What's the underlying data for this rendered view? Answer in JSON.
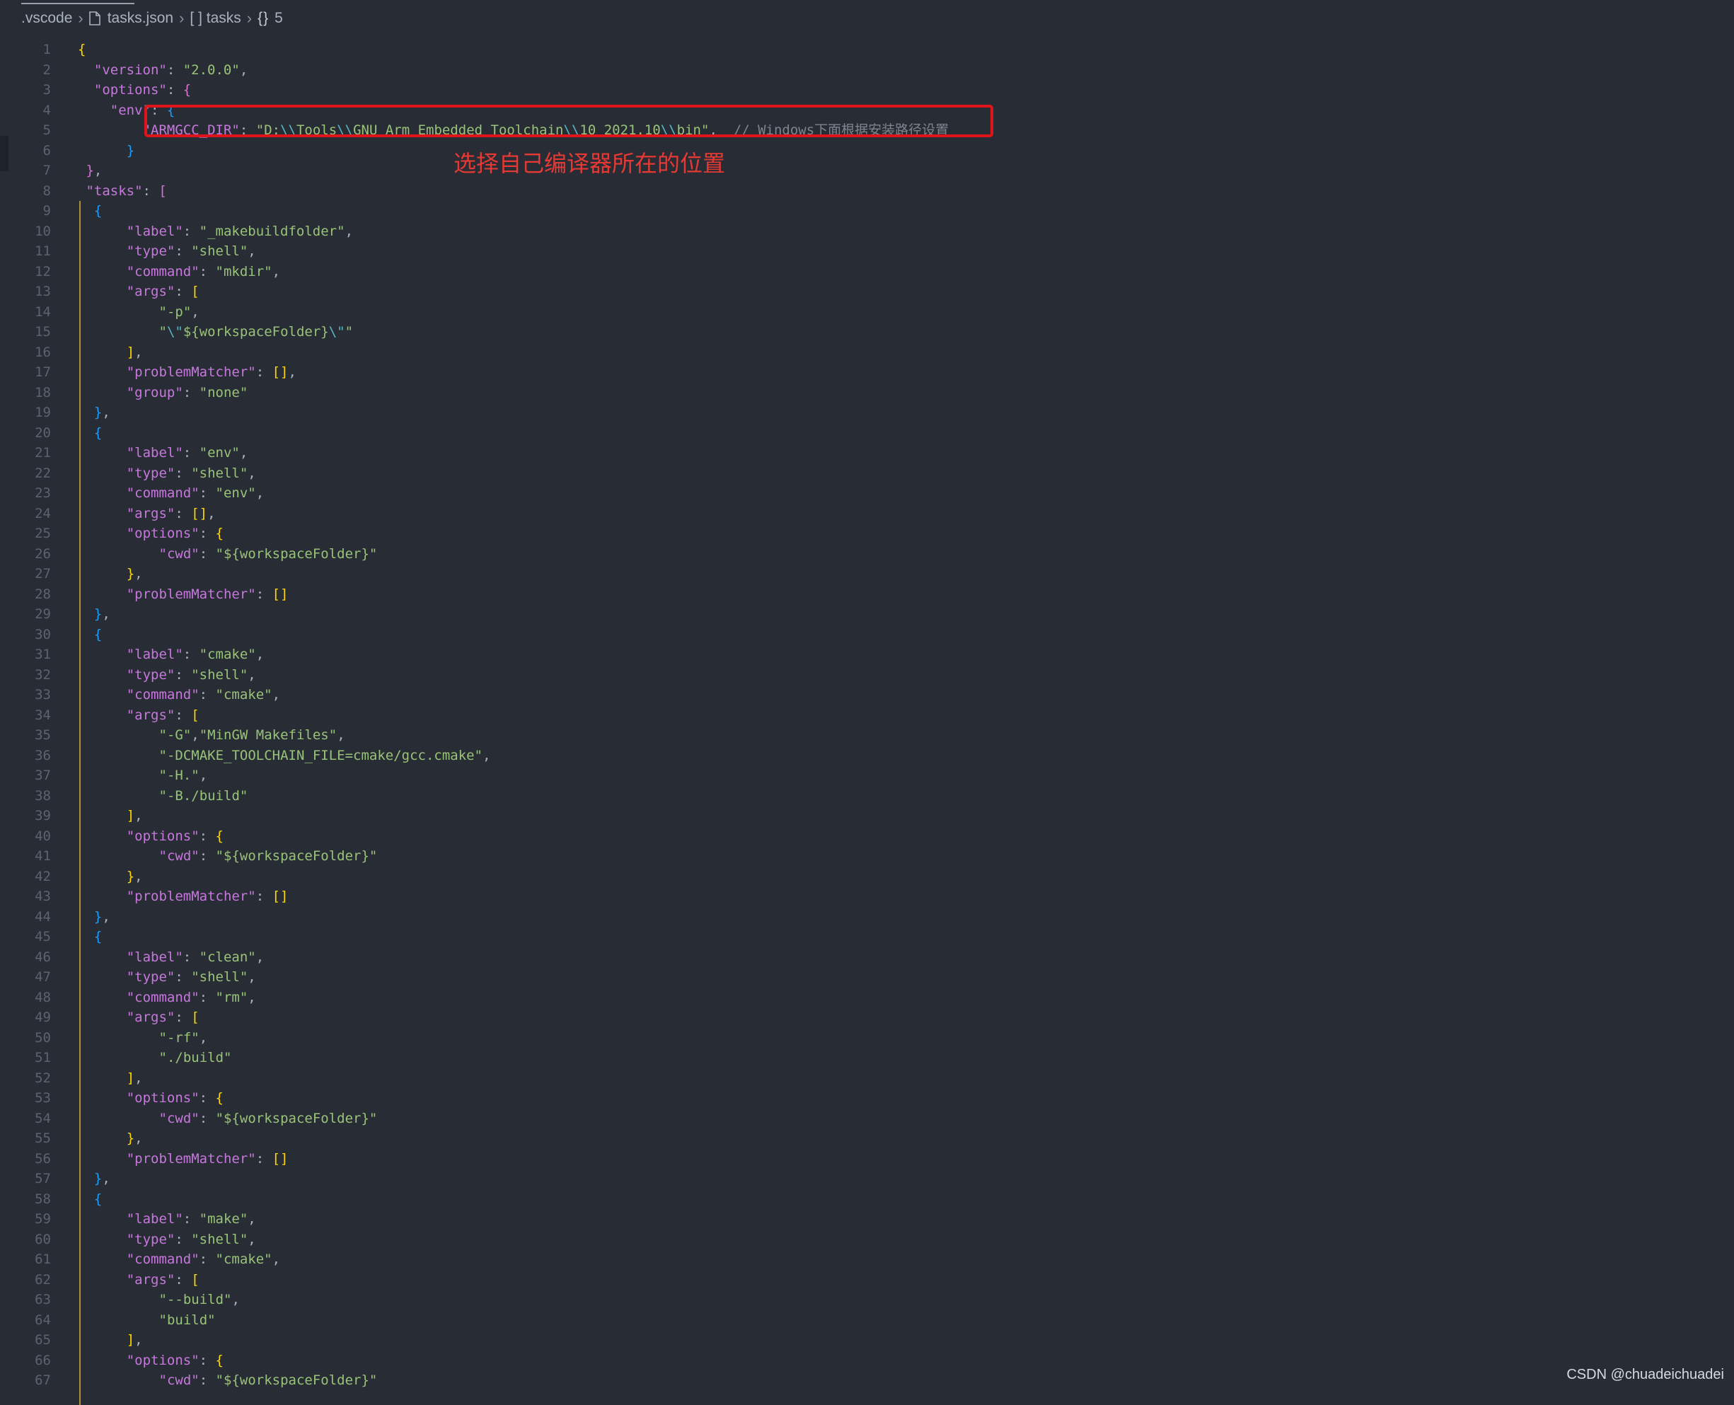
{
  "breadcrumb": {
    "items": [
      ".vscode",
      "tasks.json",
      "[ ] tasks",
      "5"
    ],
    "symbol_icon_text": "{}",
    "separator": "›"
  },
  "annotation": {
    "text": "选择自己编译器所在的位置"
  },
  "watermark": "CSDN @chuadeichuadei",
  "colors": {
    "background": "#282c34",
    "key": "#c678dd",
    "string": "#98c379",
    "comment": "#7f848e",
    "highlight_box": "#e0151c",
    "annotation": "#e53935"
  },
  "code_lines": [
    [
      [
        "{",
        "br1"
      ]
    ],
    [
      [
        "\"version\"",
        "t-key"
      ],
      [
        ": ",
        "t-punc"
      ],
      [
        "\"2.0.0\"",
        "t-str"
      ],
      [
        ",",
        "t-punc"
      ]
    ],
    [
      [
        "\"options\"",
        "t-key"
      ],
      [
        ": ",
        "t-punc"
      ],
      [
        "{",
        "br2"
      ]
    ],
    [
      [
        "\"env\"",
        "t-key"
      ],
      [
        ": ",
        "t-punc"
      ],
      [
        "{",
        "br3"
      ]
    ],
    [
      [
        "\"ARMGCC_DIR\"",
        "t-key"
      ],
      [
        ": ",
        "t-punc"
      ],
      [
        "\"D:",
        "t-str"
      ],
      [
        "\\\\",
        "t-esc"
      ],
      [
        "Tools",
        "t-str"
      ],
      [
        "\\\\",
        "t-esc"
      ],
      [
        "GNU Arm Embedded Toolchain",
        "t-str"
      ],
      [
        "\\\\",
        "t-esc"
      ],
      [
        "10 2021.10",
        "t-str"
      ],
      [
        "\\\\",
        "t-esc"
      ],
      [
        "bin\"",
        "t-str"
      ],
      [
        ",  ",
        "t-punc"
      ],
      [
        "// Windows下面根据安装路径设置",
        "t-com"
      ]
    ],
    [
      [
        "}",
        "br3"
      ]
    ],
    [
      [
        "}",
        "br2"
      ],
      [
        ",",
        "t-punc"
      ]
    ],
    [
      [
        "\"tasks\"",
        "t-key"
      ],
      [
        ": ",
        "t-punc"
      ],
      [
        "[",
        "br2"
      ]
    ],
    [
      [
        "{",
        "br3"
      ]
    ],
    [
      [
        "\"label\"",
        "t-key"
      ],
      [
        ": ",
        "t-punc"
      ],
      [
        "\"_makebuildfolder\"",
        "t-str"
      ],
      [
        ",",
        "t-punc"
      ]
    ],
    [
      [
        "\"type\"",
        "t-key"
      ],
      [
        ": ",
        "t-punc"
      ],
      [
        "\"shell\"",
        "t-str"
      ],
      [
        ",",
        "t-punc"
      ]
    ],
    [
      [
        "\"command\"",
        "t-key"
      ],
      [
        ": ",
        "t-punc"
      ],
      [
        "\"mkdir\"",
        "t-str"
      ],
      [
        ",",
        "t-punc"
      ]
    ],
    [
      [
        "\"args\"",
        "t-key"
      ],
      [
        ": ",
        "t-punc"
      ],
      [
        "[",
        "br1"
      ]
    ],
    [
      [
        "\"-p\"",
        "t-str"
      ],
      [
        ",",
        "t-punc"
      ]
    ],
    [
      [
        "\"",
        "t-str"
      ],
      [
        "\\\"",
        "t-esc"
      ],
      [
        "${workspaceFolder}",
        "t-str"
      ],
      [
        "\\\"",
        "t-esc"
      ],
      [
        "\"",
        "t-str"
      ]
    ],
    [
      [
        "]",
        "br1"
      ],
      [
        ",",
        "t-punc"
      ]
    ],
    [
      [
        "\"problemMatcher\"",
        "t-key"
      ],
      [
        ": ",
        "t-punc"
      ],
      [
        "[]",
        "br1"
      ],
      [
        ",",
        "t-punc"
      ]
    ],
    [
      [
        "\"group\"",
        "t-key"
      ],
      [
        ": ",
        "t-punc"
      ],
      [
        "\"none\"",
        "t-str"
      ]
    ],
    [
      [
        "}",
        "br3"
      ],
      [
        ",",
        "t-punc"
      ]
    ],
    [
      [
        "{",
        "br3"
      ]
    ],
    [
      [
        "\"label\"",
        "t-key"
      ],
      [
        ": ",
        "t-punc"
      ],
      [
        "\"env\"",
        "t-str"
      ],
      [
        ",",
        "t-punc"
      ]
    ],
    [
      [
        "\"type\"",
        "t-key"
      ],
      [
        ": ",
        "t-punc"
      ],
      [
        "\"shell\"",
        "t-str"
      ],
      [
        ",",
        "t-punc"
      ]
    ],
    [
      [
        "\"command\"",
        "t-key"
      ],
      [
        ": ",
        "t-punc"
      ],
      [
        "\"env\"",
        "t-str"
      ],
      [
        ",",
        "t-punc"
      ]
    ],
    [
      [
        "\"args\"",
        "t-key"
      ],
      [
        ": ",
        "t-punc"
      ],
      [
        "[]",
        "br1"
      ],
      [
        ",",
        "t-punc"
      ]
    ],
    [
      [
        "\"options\"",
        "t-key"
      ],
      [
        ": ",
        "t-punc"
      ],
      [
        "{",
        "br1"
      ]
    ],
    [
      [
        "\"cwd\"",
        "t-key"
      ],
      [
        ": ",
        "t-punc"
      ],
      [
        "\"${workspaceFolder}\"",
        "t-str"
      ]
    ],
    [
      [
        "}",
        "br1"
      ],
      [
        ",",
        "t-punc"
      ]
    ],
    [
      [
        "\"problemMatcher\"",
        "t-key"
      ],
      [
        ": ",
        "t-punc"
      ],
      [
        "[]",
        "br1"
      ]
    ],
    [
      [
        "}",
        "br3"
      ],
      [
        ",",
        "t-punc"
      ]
    ],
    [
      [
        "{",
        "br3"
      ]
    ],
    [
      [
        "\"label\"",
        "t-key"
      ],
      [
        ": ",
        "t-punc"
      ],
      [
        "\"cmake\"",
        "t-str"
      ],
      [
        ",",
        "t-punc"
      ]
    ],
    [
      [
        "\"type\"",
        "t-key"
      ],
      [
        ": ",
        "t-punc"
      ],
      [
        "\"shell\"",
        "t-str"
      ],
      [
        ",",
        "t-punc"
      ]
    ],
    [
      [
        "\"command\"",
        "t-key"
      ],
      [
        ": ",
        "t-punc"
      ],
      [
        "\"cmake\"",
        "t-str"
      ],
      [
        ",",
        "t-punc"
      ]
    ],
    [
      [
        "\"args\"",
        "t-key"
      ],
      [
        ": ",
        "t-punc"
      ],
      [
        "[",
        "br1"
      ]
    ],
    [
      [
        "\"-G\"",
        "t-str"
      ],
      [
        ",",
        "t-punc"
      ],
      [
        "\"MinGW Makefiles\"",
        "t-str"
      ],
      [
        ",",
        "t-punc"
      ]
    ],
    [
      [
        "\"-DCMAKE_TOOLCHAIN_FILE=cmake/gcc.cmake\"",
        "t-str"
      ],
      [
        ",",
        "t-punc"
      ]
    ],
    [
      [
        "\"-H.\"",
        "t-str"
      ],
      [
        ",",
        "t-punc"
      ]
    ],
    [
      [
        "\"-B./build\"",
        "t-str"
      ]
    ],
    [
      [
        "]",
        "br1"
      ],
      [
        ",",
        "t-punc"
      ]
    ],
    [
      [
        "\"options\"",
        "t-key"
      ],
      [
        ": ",
        "t-punc"
      ],
      [
        "{",
        "br1"
      ]
    ],
    [
      [
        "\"cwd\"",
        "t-key"
      ],
      [
        ": ",
        "t-punc"
      ],
      [
        "\"${workspaceFolder}\"",
        "t-str"
      ]
    ],
    [
      [
        "}",
        "br1"
      ],
      [
        ",",
        "t-punc"
      ]
    ],
    [
      [
        "\"problemMatcher\"",
        "t-key"
      ],
      [
        ": ",
        "t-punc"
      ],
      [
        "[]",
        "br1"
      ]
    ],
    [
      [
        "}",
        "br3"
      ],
      [
        ",",
        "t-punc"
      ]
    ],
    [
      [
        "{",
        "br3"
      ]
    ],
    [
      [
        "\"label\"",
        "t-key"
      ],
      [
        ": ",
        "t-punc"
      ],
      [
        "\"clean\"",
        "t-str"
      ],
      [
        ",",
        "t-punc"
      ]
    ],
    [
      [
        "\"type\"",
        "t-key"
      ],
      [
        ": ",
        "t-punc"
      ],
      [
        "\"shell\"",
        "t-str"
      ],
      [
        ",",
        "t-punc"
      ]
    ],
    [
      [
        "\"command\"",
        "t-key"
      ],
      [
        ": ",
        "t-punc"
      ],
      [
        "\"rm\"",
        "t-str"
      ],
      [
        ",",
        "t-punc"
      ]
    ],
    [
      [
        "\"args\"",
        "t-key"
      ],
      [
        ": ",
        "t-punc"
      ],
      [
        "[",
        "br1"
      ]
    ],
    [
      [
        "\"-rf\"",
        "t-str"
      ],
      [
        ",",
        "t-punc"
      ]
    ],
    [
      [
        "\"./build\"",
        "t-str"
      ]
    ],
    [
      [
        "]",
        "br1"
      ],
      [
        ",",
        "t-punc"
      ]
    ],
    [
      [
        "\"options\"",
        "t-key"
      ],
      [
        ": ",
        "t-punc"
      ],
      [
        "{",
        "br1"
      ]
    ],
    [
      [
        "\"cwd\"",
        "t-key"
      ],
      [
        ": ",
        "t-punc"
      ],
      [
        "\"${workspaceFolder}\"",
        "t-str"
      ]
    ],
    [
      [
        "}",
        "br1"
      ],
      [
        ",",
        "t-punc"
      ]
    ],
    [
      [
        "\"problemMatcher\"",
        "t-key"
      ],
      [
        ": ",
        "t-punc"
      ],
      [
        "[]",
        "br1"
      ]
    ],
    [
      [
        "}",
        "br3"
      ],
      [
        ",",
        "t-punc"
      ]
    ],
    [
      [
        "{",
        "br3"
      ]
    ],
    [
      [
        "\"label\"",
        "t-key"
      ],
      [
        ": ",
        "t-punc"
      ],
      [
        "\"make\"",
        "t-str"
      ],
      [
        ",",
        "t-punc"
      ]
    ],
    [
      [
        "\"type\"",
        "t-key"
      ],
      [
        ": ",
        "t-punc"
      ],
      [
        "\"shell\"",
        "t-str"
      ],
      [
        ",",
        "t-punc"
      ]
    ],
    [
      [
        "\"command\"",
        "t-key"
      ],
      [
        ": ",
        "t-punc"
      ],
      [
        "\"cmake\"",
        "t-str"
      ],
      [
        ",",
        "t-punc"
      ]
    ],
    [
      [
        "\"args\"",
        "t-key"
      ],
      [
        ": ",
        "t-punc"
      ],
      [
        "[",
        "br1"
      ]
    ],
    [
      [
        "\"--build\"",
        "t-str"
      ],
      [
        ",",
        "t-punc"
      ]
    ],
    [
      [
        "\"build\"",
        "t-str"
      ]
    ],
    [
      [
        "]",
        "br1"
      ],
      [
        ",",
        "t-punc"
      ]
    ],
    [
      [
        "\"options\"",
        "t-key"
      ],
      [
        ": ",
        "t-punc"
      ],
      [
        "{",
        "br1"
      ]
    ],
    [
      [
        "\"cwd\"",
        "t-key"
      ],
      [
        ": ",
        "t-punc"
      ],
      [
        "\"${workspaceFolder}\"",
        "t-str"
      ]
    ]
  ]
}
